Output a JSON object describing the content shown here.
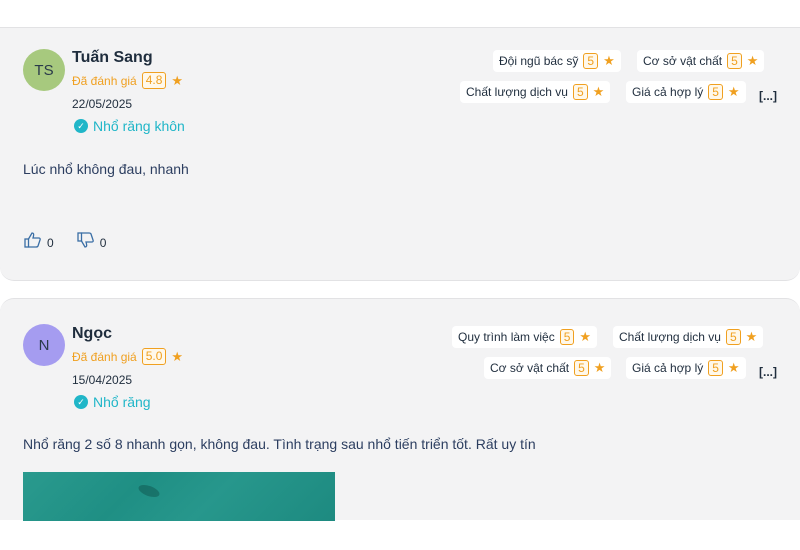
{
  "reviews": [
    {
      "initials": "TS",
      "avatar_color": "#a7c97e",
      "name": "Tuấn Sang",
      "rated_label": "Đã đánh giá",
      "overall_score": "4.8",
      "date": "22/05/2025",
      "service": "Nhổ răng khôn",
      "comment": "Lúc nhổ không đau, nhanh",
      "criteria": [
        {
          "label": "Đội ngũ bác sỹ",
          "score": "5"
        },
        {
          "label": "Cơ sở vật chất",
          "score": "5"
        },
        {
          "label": "Chất lượng dịch vụ",
          "score": "5"
        },
        {
          "label": "Giá cả hợp lý",
          "score": "5"
        }
      ],
      "more": "[...]",
      "likes": "0",
      "dislikes": "0"
    },
    {
      "initials": "N",
      "avatar_color": "#a59cf0",
      "name": "Ngọc",
      "rated_label": "Đã đánh giá",
      "overall_score": "5.0",
      "date": "15/04/2025",
      "service": "Nhổ răng",
      "comment": "Nhổ răng 2 số 8 nhanh gọn, không đau. Tình trạng sau nhổ tiến triển tốt. Rất uy tín",
      "criteria": [
        {
          "label": "Quy trình làm việc",
          "score": "5"
        },
        {
          "label": "Chất lượng dịch vụ",
          "score": "5"
        },
        {
          "label": "Cơ sở vật chất",
          "score": "5"
        },
        {
          "label": "Giá cả hợp lý",
          "score": "5"
        }
      ],
      "more": "[...]"
    }
  ],
  "colors": {
    "accent_orange": "#f0a020",
    "accent_teal": "#20b6c8",
    "card_bg": "#f3f3f4"
  },
  "icons": {
    "star": "star-icon",
    "check": "check-circle-icon",
    "like": "thumbs-up-icon",
    "dislike": "thumbs-down-icon"
  }
}
